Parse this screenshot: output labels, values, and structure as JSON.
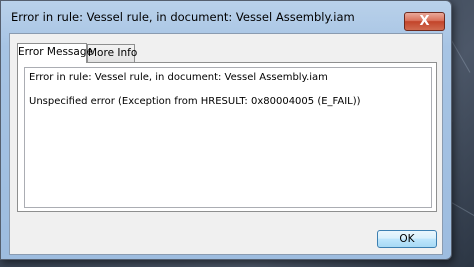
{
  "window": {
    "title": "Error in rule: Vessel rule, in document: Vessel Assembly.iam",
    "close_label": "X"
  },
  "tabs": [
    {
      "label": "Error Message",
      "selected": true
    },
    {
      "label": "More Info",
      "selected": false
    }
  ],
  "message": {
    "line1": "Error in rule: Vessel rule, in document: Vessel Assembly.iam",
    "line2": "Unspecified error (Exception from HRESULT: 0x80004005 (E_FAIL))"
  },
  "buttons": {
    "ok_label": "OK"
  },
  "icons": {
    "close": "close-icon"
  }
}
